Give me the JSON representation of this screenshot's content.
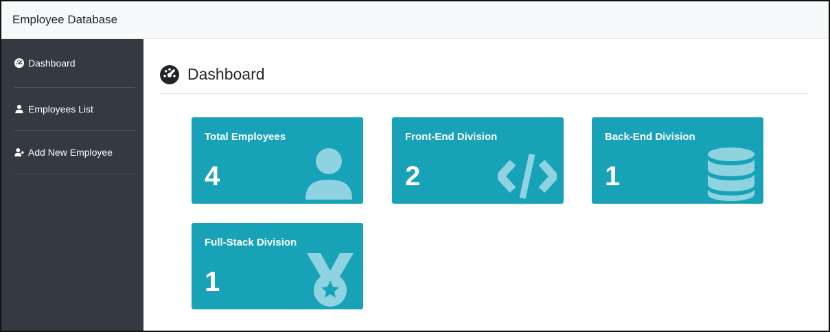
{
  "app": {
    "title": "Employee Database"
  },
  "sidebar": {
    "items": [
      {
        "label": "Dashboard",
        "icon": "tachometer-icon"
      },
      {
        "label": "Employees List",
        "icon": "user-icon"
      },
      {
        "label": "Add New Employee",
        "icon": "user-plus-icon"
      }
    ]
  },
  "page": {
    "title": "Dashboard",
    "icon": "tachometer-icon"
  },
  "cards": [
    {
      "label": "Total Employees",
      "value": "4",
      "icon": "user-icon"
    },
    {
      "label": "Front-End Division",
      "value": "2",
      "icon": "code-icon"
    },
    {
      "label": "Back-End Division",
      "value": "1",
      "icon": "database-icon"
    },
    {
      "label": "Full-Stack Division",
      "value": "1",
      "icon": "medal-icon"
    }
  ],
  "colors": {
    "sidebar": "#343a40",
    "card": "#17a2b8",
    "card_icon": "#8fd3e0",
    "topbar": "#f8f9fa"
  }
}
